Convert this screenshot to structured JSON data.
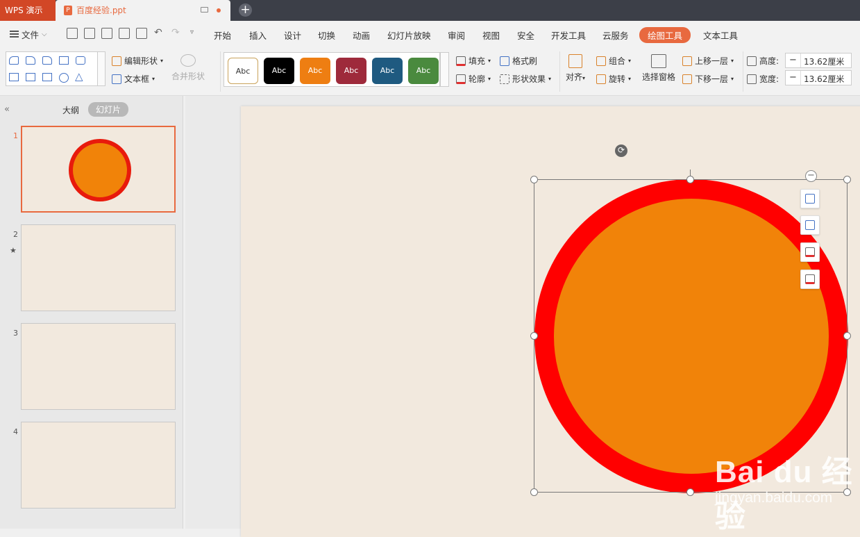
{
  "titlebar": {
    "app_label": "WPS 演示",
    "doc_tab": "百度经验.ppt",
    "ppt_badge": "P",
    "new_tab": "+"
  },
  "menubar": {
    "file": "文件",
    "items": [
      "开始",
      "插入",
      "设计",
      "切换",
      "动画",
      "幻灯片放映",
      "审阅",
      "视图",
      "安全",
      "开发工具",
      "云服务",
      "绘图工具",
      "文本工具"
    ],
    "active_item": "绘图工具"
  },
  "ribbon": {
    "edit_shape": "编辑形状",
    "text_box": "文本框",
    "merge_shape": "合并形状",
    "style_label": "Abc",
    "styles": [
      {
        "label": "Abc",
        "bg": "#ffffff",
        "fg": "#333333",
        "border": "#c9a25a"
      },
      {
        "label": "Abc",
        "bg": "#000000",
        "fg": "#ffffff"
      },
      {
        "label": "Abc",
        "bg": "#ee7e12",
        "fg": "#ffffff"
      },
      {
        "label": "Abc",
        "bg": "#9e2a3b",
        "fg": "#ffffff"
      },
      {
        "label": "Abc",
        "bg": "#1f5a80",
        "fg": "#ffffff"
      },
      {
        "label": "Abc",
        "bg": "#4a8a3e",
        "fg": "#ffffff"
      }
    ],
    "fill": "填充",
    "format_painter": "格式刷",
    "outline": "轮廓",
    "shape_effects": "形状效果",
    "align": "对齐",
    "group": "组合",
    "rotate": "旋转",
    "selection_pane": "选择窗格",
    "bring_forward": "上移一层",
    "send_backward": "下移一层",
    "height_label": "高度:",
    "height_value": "13.62厘米",
    "width_label": "宽度:",
    "width_value": "13.62厘米"
  },
  "leftpane": {
    "outline_tab": "大纲",
    "slides_tab": "幻灯片",
    "slides": [
      {
        "num": "1",
        "selected": true,
        "has_circle": true
      },
      {
        "num": "2",
        "selected": false,
        "has_circle": false,
        "anim_mark": "★"
      },
      {
        "num": "3",
        "selected": false,
        "has_circle": false
      },
      {
        "num": "4",
        "selected": false,
        "has_circle": false
      }
    ]
  },
  "canvas": {
    "shape": {
      "type": "circle",
      "fill": "#f18309",
      "outline": "#ff0000"
    },
    "watermark_logo": "Bai du 经验",
    "watermark_url": "jingyan.baidu.com"
  }
}
